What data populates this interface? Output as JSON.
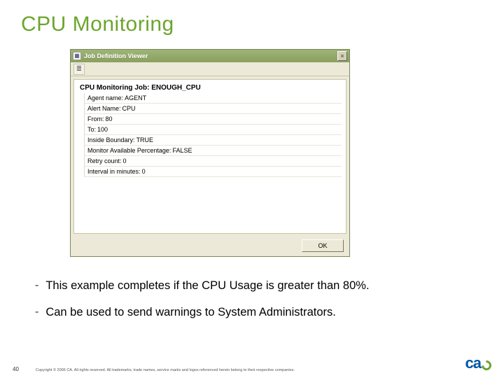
{
  "title": "CPU Monitoring",
  "window": {
    "title": "Job Definition Viewer",
    "close_label": "×",
    "job_heading": "CPU Monitoring Job: ENOUGH_CPU",
    "fields": [
      {
        "label": "Agent name",
        "value": "AGENT"
      },
      {
        "label": "Alert Name",
        "value": "CPU"
      },
      {
        "label": "From",
        "value": "80"
      },
      {
        "label": "To",
        "value": "100"
      },
      {
        "label": "Inside Boundary",
        "value": "TRUE"
      },
      {
        "label": "Monitor Available Percentage",
        "value": "FALSE"
      },
      {
        "label": "Retry count",
        "value": "0"
      },
      {
        "label": "Interval in minutes",
        "value": "0"
      }
    ],
    "ok_label": "OK"
  },
  "bullets": [
    "This example completes if the CPU Usage is greater than 80%.",
    "Can be used to send warnings to System Administrators."
  ],
  "footer": {
    "page": "40",
    "copyright": "Copyright © 2006 CA. All rights reserved. All trademarks, trade names, service marks and logos referenced herein belong to their respective companies."
  },
  "logo_text": "ca"
}
